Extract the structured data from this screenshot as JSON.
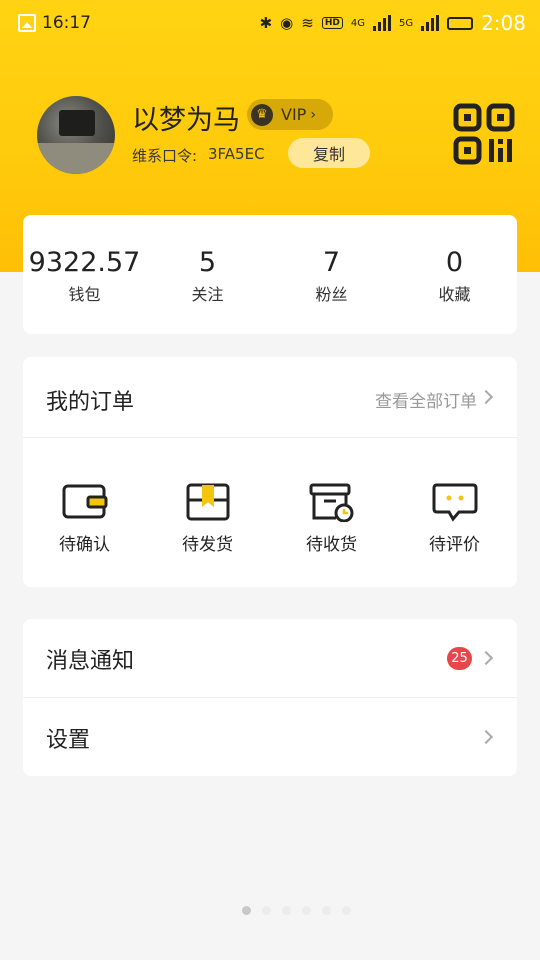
{
  "status_bar": {
    "time_left": "16:17",
    "time_right": "2:08",
    "net_4g": "4G",
    "net_5g": "5G",
    "hd": "HD"
  },
  "profile": {
    "username": "以梦为马",
    "vip_label": "VIP",
    "invite_label": "维系口令:",
    "invite_code": "3FA5EC",
    "copy_label": "复制"
  },
  "stats": [
    {
      "value": "9322.57",
      "label": "钱包"
    },
    {
      "value": "5",
      "label": "关注"
    },
    {
      "value": "7",
      "label": "粉丝"
    },
    {
      "value": "0",
      "label": "收藏"
    }
  ],
  "orders": {
    "title": "我的订单",
    "view_all": "查看全部订单",
    "items": [
      {
        "label": "待确认",
        "icon": "wallet-icon"
      },
      {
        "label": "待发货",
        "icon": "package-icon"
      },
      {
        "label": "待收货",
        "icon": "box-clock-icon"
      },
      {
        "label": "待评价",
        "icon": "chat-bubble-icon"
      }
    ]
  },
  "menu": [
    {
      "label": "消息通知",
      "badge": "25"
    },
    {
      "label": "设置"
    }
  ],
  "colors": {
    "header_yellow": "#ffcb0c",
    "accent_yellow": "#f3c511",
    "badge_red": "#e8464a"
  }
}
